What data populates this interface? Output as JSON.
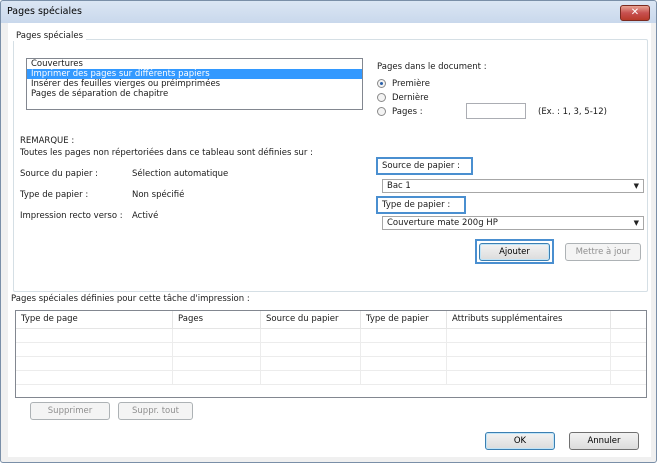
{
  "window": {
    "title": "Pages spéciales",
    "close_glyph": "✕"
  },
  "group": {
    "title": "Pages spéciales",
    "list_items": [
      "Couvertures",
      "Imprimer des pages sur différents papiers",
      "Insérer des feuilles vierges ou préimprimées",
      "Pages de séparation de chapitre"
    ],
    "selected_index": 1
  },
  "pages_doc": {
    "label": "Pages dans le document :",
    "options": [
      "Première",
      "Dernière",
      "Pages :"
    ],
    "selected": "Première",
    "pages_value": "",
    "pages_hint": "(Ex. : 1, 3, 5-12)"
  },
  "remark": {
    "title": "REMARQUE :",
    "text": "Toutes les pages non répertoriées dans ce tableau sont définies sur :",
    "rows": [
      {
        "label": "Source du papier :",
        "value": "Sélection automatique"
      },
      {
        "label": "Type de papier :",
        "value": "Non spécifié"
      },
      {
        "label": "Impression recto verso :",
        "value": "Activé"
      }
    ]
  },
  "paper": {
    "source_label": "Source de papier :",
    "source_value": "Bac 1",
    "type_label": "Type de papier :",
    "type_value": "Couverture mate 200g HP"
  },
  "buttons": {
    "add": "Ajouter",
    "update": "Mettre à jour",
    "delete": "Supprimer",
    "delete_all": "Suppr. tout",
    "ok": "OK",
    "cancel": "Annuler"
  },
  "table": {
    "caption": "Pages spéciales définies pour cette tâche d'impression :",
    "columns": [
      "Type de page",
      "Pages",
      "Source du papier",
      "Type de papier",
      "Attributs supplémentaires"
    ],
    "rows": []
  },
  "colors": {
    "highlight": "#4a8fd0",
    "selection": "#3399ff",
    "close": "#c75050"
  },
  "icons": {
    "dropdown": "chevron-down-icon",
    "close": "close-icon"
  }
}
